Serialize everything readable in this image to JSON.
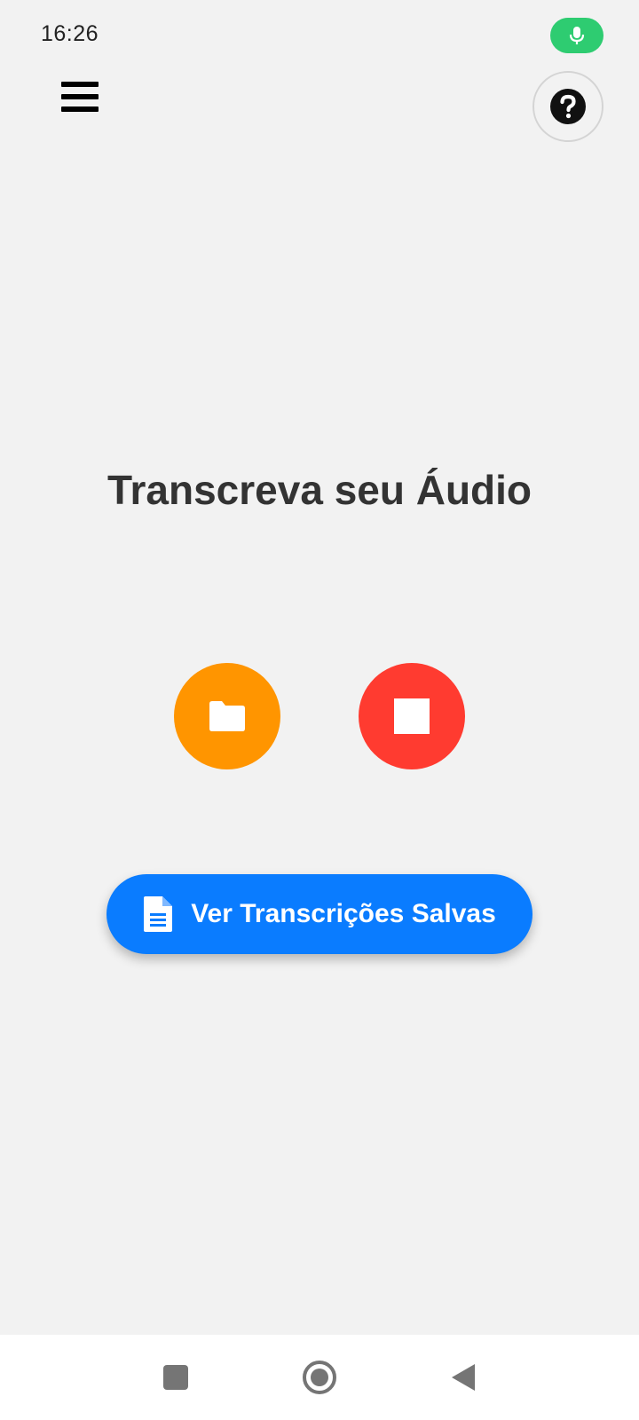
{
  "status_bar": {
    "time": "16:26",
    "mic_indicator_icon": "microphone-icon",
    "mic_indicator_color": "#2ecc71"
  },
  "header": {
    "menu_icon": "hamburger-menu-icon",
    "help_icon": "question-circle-icon"
  },
  "main": {
    "title": "Transcreva seu Áudio",
    "folder_button": {
      "icon": "folder-icon",
      "color": "#ff9500"
    },
    "stop_button": {
      "icon": "stop-icon",
      "color": "#ff3b30"
    },
    "saved_button": {
      "icon": "document-icon",
      "label": "Ver Transcrições Salvas",
      "color": "#0a7cff"
    }
  },
  "nav_bar": {
    "recent_icon": "square-icon",
    "home_icon": "circle-home-icon",
    "back_icon": "triangle-back-icon"
  }
}
